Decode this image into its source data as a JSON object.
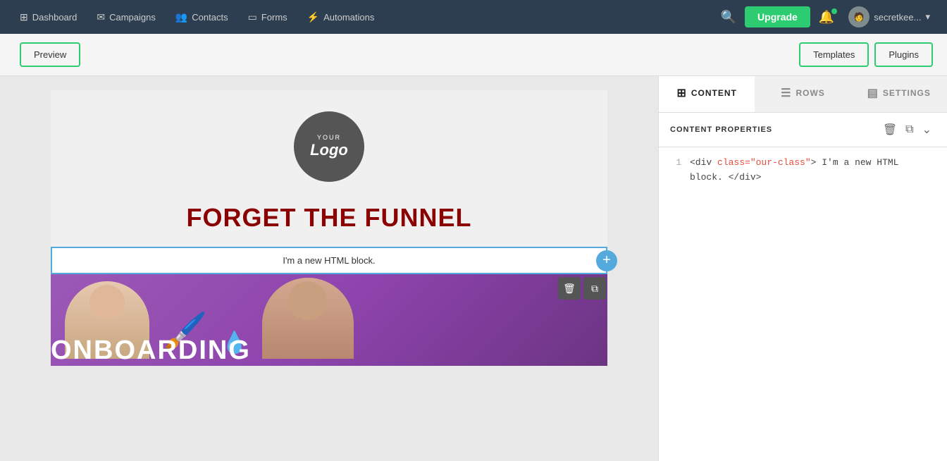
{
  "topnav": {
    "brand_icon": "⊞",
    "items": [
      {
        "label": "Dashboard",
        "icon": "⊞",
        "id": "dashboard"
      },
      {
        "label": "Campaigns",
        "icon": "✉",
        "id": "campaigns"
      },
      {
        "label": "Contacts",
        "icon": "👥",
        "id": "contacts"
      },
      {
        "label": "Forms",
        "icon": "▭",
        "id": "forms"
      },
      {
        "label": "Automations",
        "icon": "⚡",
        "id": "automations"
      }
    ],
    "upgrade_label": "Upgrade",
    "user_name": "secretkee...",
    "search_placeholder": "Search"
  },
  "toolbar": {
    "preview_label": "Preview",
    "templates_label": "Templates",
    "plugins_label": "Plugins"
  },
  "canvas": {
    "logo_your": "YOUR",
    "logo_text": "Logo",
    "headline": "FORGET THE FUNNEL",
    "html_block_text": "I'm a new HTML block.",
    "onboarding_text": "ONBOARDING"
  },
  "right_panel": {
    "tabs": [
      {
        "label": "CONTENT",
        "icon": "⊞",
        "id": "content",
        "active": true
      },
      {
        "label": "ROWS",
        "icon": "☰",
        "id": "rows",
        "active": false
      },
      {
        "label": "SETTINGS",
        "icon": "▤",
        "id": "settings",
        "active": false
      }
    ],
    "subheader_title": "CONTENT PROPERTIES",
    "action_delete": "🗑",
    "action_copy": "⧉",
    "action_collapse": "⌄",
    "code": {
      "line1_num": "1",
      "line1_tag_open": "<div",
      "line1_attr": "class=",
      "line1_value": "\"our-class\"",
      "line1_text": "> I'm a new HTML block. ",
      "line1_tag_close": "</div>"
    }
  },
  "colors": {
    "accent": "#2ecc71",
    "nav_bg": "#2c3e50",
    "tab_active_bg": "#ffffff",
    "tab_inactive_bg": "#f0f0f0"
  }
}
